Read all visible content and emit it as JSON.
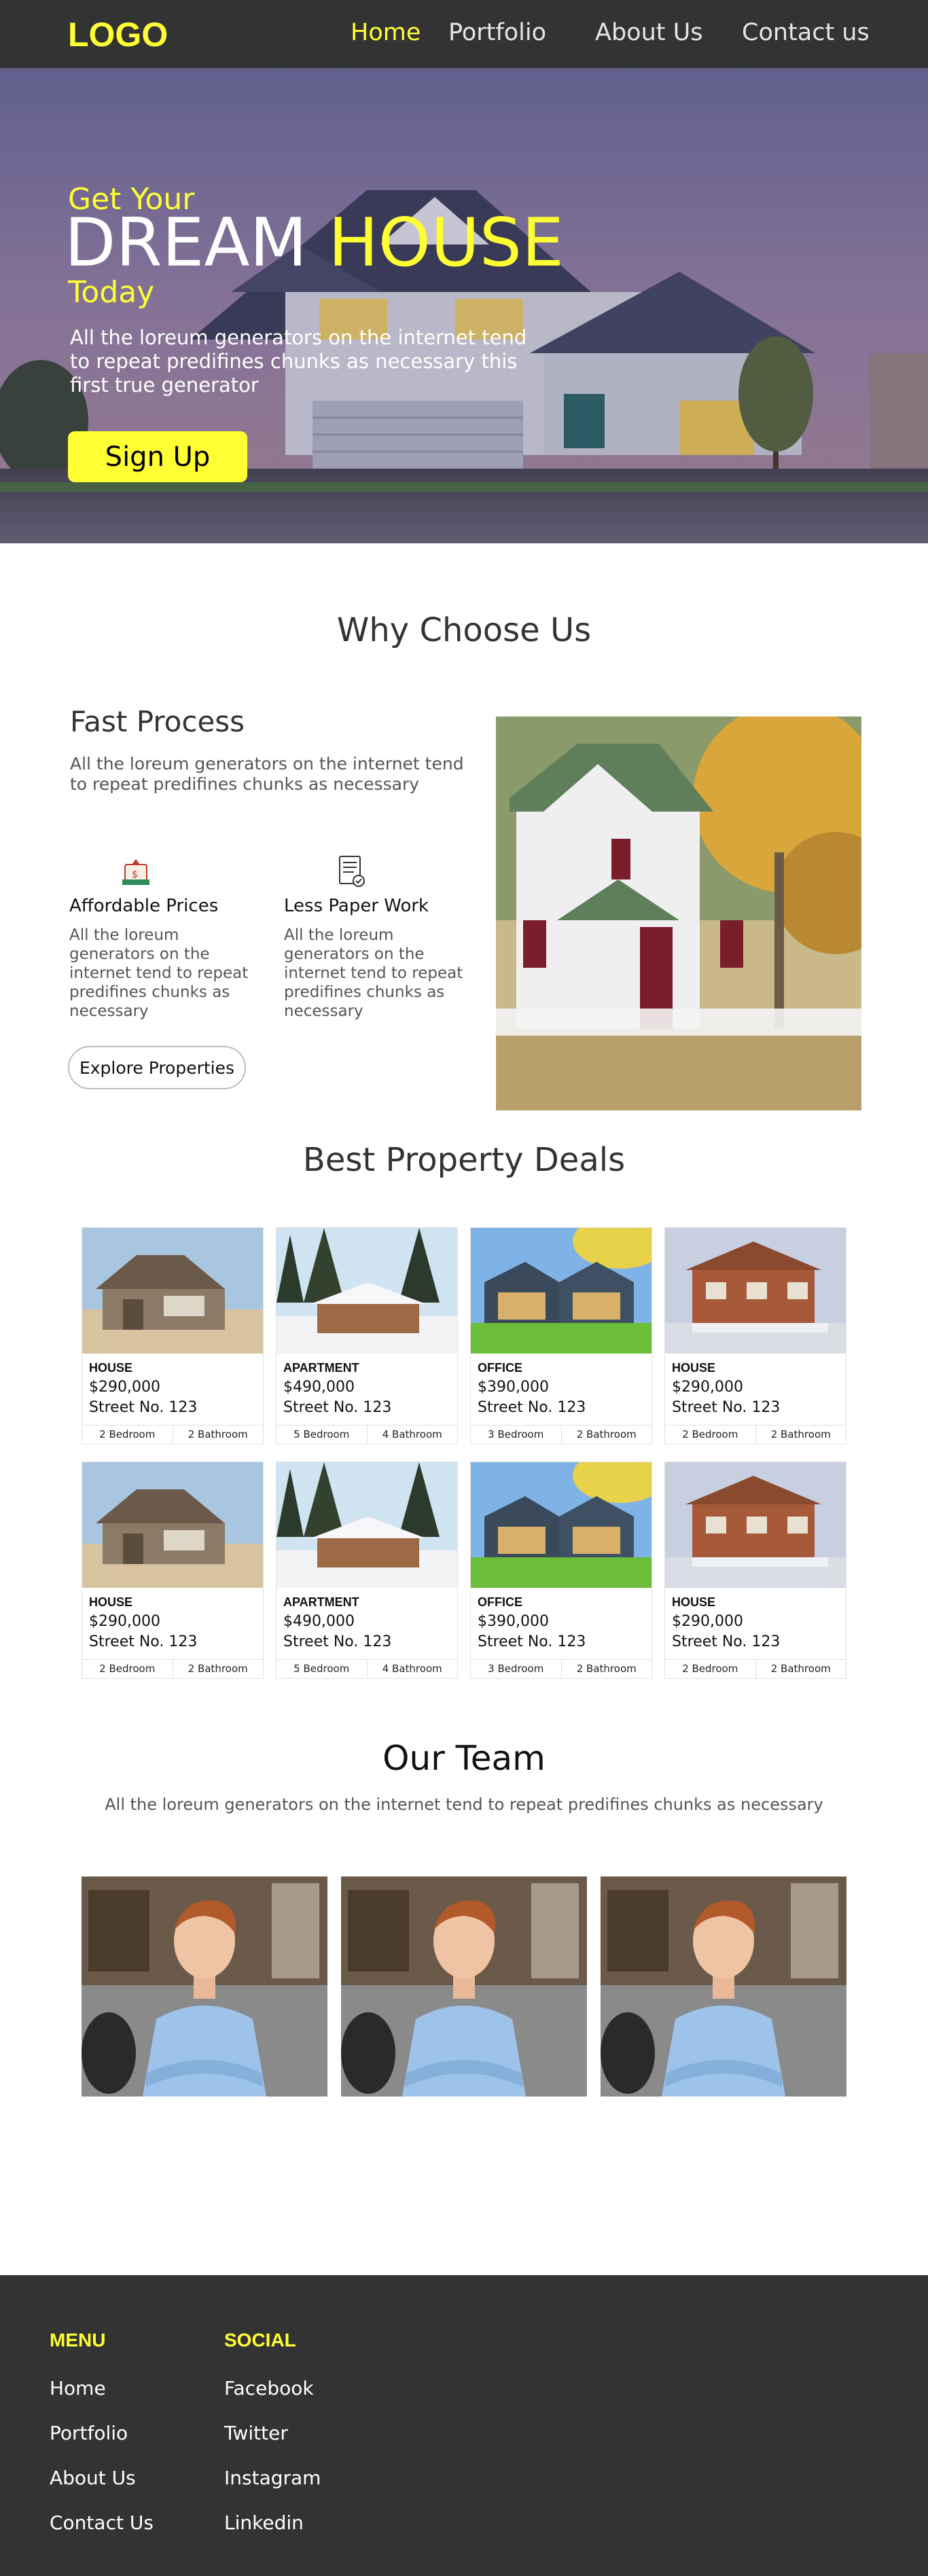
{
  "nav": {
    "logo": "LOGO",
    "links": [
      "Home",
      "Portfolio",
      "About Us",
      "Contact us"
    ],
    "active_color": "#ffff33"
  },
  "hero": {
    "line1": "Get Your",
    "dream": "DREAM ",
    "house": "HOUSE",
    "line3": "Today",
    "description": "All the loreum generators on the internet tend to repeat predifines chunks as necessary this first true generator",
    "cta": "Sign Up"
  },
  "why": {
    "title": "Why Choose Us",
    "fast_title": "Fast Process",
    "fast_desc": "All the loreum generators on the internet tend to repeat predifines chunks as necessary",
    "features": [
      {
        "icon": "price-icon",
        "title": "Affordable Prices",
        "desc": "All the loreum generators on the internet tend to repeat predifines chunks as necessary"
      },
      {
        "icon": "document-icon",
        "title": "Less Paper Work",
        "desc": "All the loreum generators on the internet tend to repeat predifines chunks as necessary"
      }
    ],
    "explore": "Explore Properties"
  },
  "deals": {
    "title": "Best Property Deals",
    "cards": [
      {
        "type": "HOUSE",
        "price": "$290,000",
        "street": "Street No. 123",
        "f1": "2 Bedroom",
        "f2": "2 Bathroom"
      },
      {
        "type": "APARTMENT",
        "price": "$490,000",
        "street": "Street No. 123",
        "f1": "5 Bedroom",
        "f2": "4 Bathroom"
      },
      {
        "type": "OFFICE",
        "price": "$390,000",
        "street": "Street No. 123",
        "f1": "3 Bedroom",
        "f2": "2 Bathroom"
      },
      {
        "type": "HOUSE",
        "price": "$290,000",
        "street": "Street No. 123",
        "f1": "2 Bedroom",
        "f2": "2 Bathroom"
      },
      {
        "type": "HOUSE",
        "price": "$290,000",
        "street": "Street No. 123",
        "f1": "2 Bedroom",
        "f2": "2 Bathroom"
      },
      {
        "type": "APARTMENT",
        "price": "$490,000",
        "street": "Street No. 123",
        "f1": "5 Bedroom",
        "f2": "4 Bathroom"
      },
      {
        "type": "OFFICE",
        "price": "$390,000",
        "street": "Street No. 123",
        "f1": "3 Bedroom",
        "f2": "2 Bathroom"
      },
      {
        "type": "HOUSE",
        "price": "$290,000",
        "street": "Street No. 123",
        "f1": "2 Bedroom",
        "f2": "2 Bathroom"
      }
    ]
  },
  "team": {
    "title": "Our Team",
    "desc": "All the loreum generators on the internet tend to repeat predifines chunks as necessary"
  },
  "footer": {
    "menu_title": "MENU",
    "menu": [
      "Home",
      "Portfolio",
      "About Us",
      "Contact Us"
    ],
    "social_title": "SOCIAL",
    "social": [
      "Facebook",
      "Twitter",
      "Instagram",
      "Linkedin"
    ]
  }
}
